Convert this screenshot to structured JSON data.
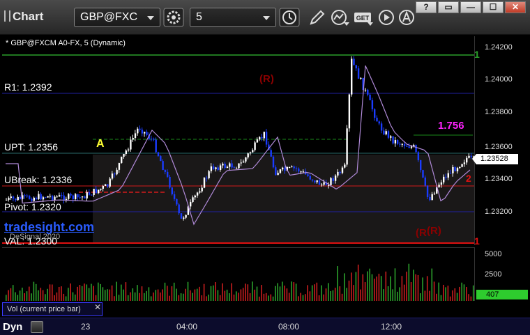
{
  "toolbar": {
    "app_title": "Chart",
    "symbol": "GBP@FXC",
    "interval": "5",
    "icons": [
      "settings-gear-icon",
      "clock-icon",
      "pencil-draw-icon",
      "study-icon",
      "get-icon",
      "play-icon",
      "alert-a-icon"
    ]
  },
  "window": {
    "help": "?",
    "restore": "▭",
    "minimize": "—",
    "maximize": "☐",
    "close": "✕"
  },
  "chart": {
    "header": "* GBP@FXCM A0-FX, 5 (Dynamic)",
    "last_price": "1.23528",
    "price_axis": [
      "1.24200",
      "1.24000",
      "1.23800",
      "1.23600",
      "1.23400",
      "1.23200"
    ],
    "levels": {
      "r1": "R1: 1.2392",
      "upt": "UPT: 1.2356",
      "ubreak": "UBreak: 1.2336",
      "pivot": "Pivot: 1.2320",
      "val": "VAL: 1.2300"
    },
    "overlay_text": {
      "watermark": "tradesight.com",
      "source": "DeSignal 2020",
      "marker_a": "A",
      "pivot_r_top": "(R)",
      "pivot_r_bottom_1": "(R",
      "pivot_r_bottom_2": "(R)",
      "seq_label": "1.756",
      "line_num_top": "1",
      "line_num_mid": "2",
      "line_num_bottom": "1"
    },
    "colors": {
      "bull": "#ffffff",
      "bear": "#1a3cff",
      "r1": "#2020a0",
      "upt": "#1a8a1a",
      "ubreak": "#d11a1a",
      "pivot": "#2020a0",
      "val": "#e01010",
      "top_green": "#2aa02a"
    }
  },
  "volume": {
    "axis": [
      "5000",
      "2500"
    ],
    "last_volume": "407",
    "caption": "Vol (current price bar)",
    "close_glyph": "✕"
  },
  "time_axis": [
    "23",
    "04:00",
    "08:00",
    "12:00"
  ],
  "bottom": {
    "dyn_label": "Dyn"
  }
}
